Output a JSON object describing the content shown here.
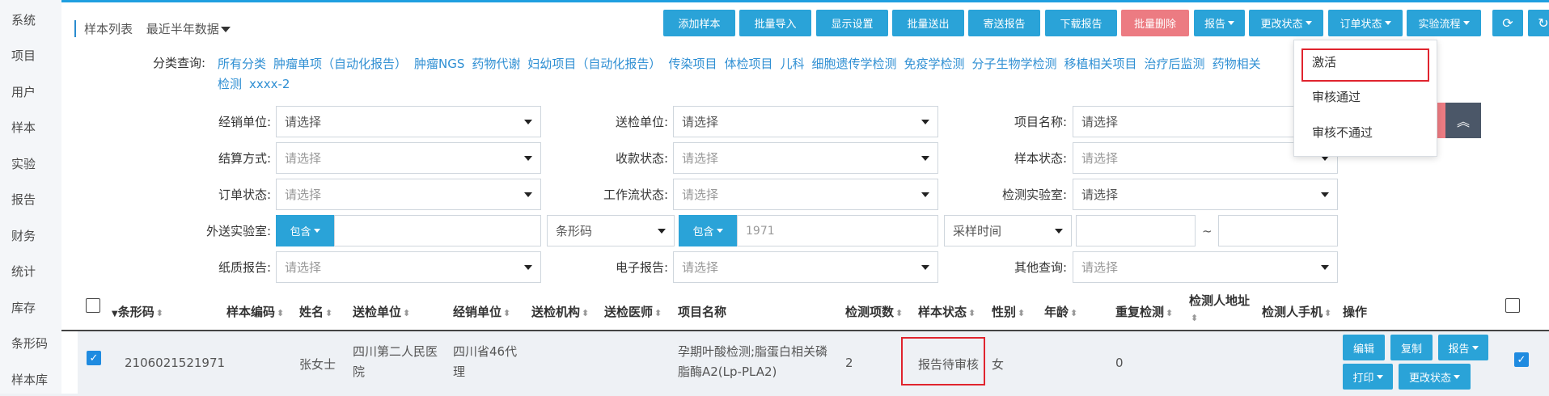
{
  "nav": [
    "系统",
    "项目",
    "用户",
    "样本",
    "实验",
    "报告",
    "财务",
    "统计",
    "库存",
    "条形码",
    "样本库"
  ],
  "header": {
    "title": "样本列表",
    "range": "最近半年数据"
  },
  "toolbar": [
    "添加样本",
    "批量导入",
    "显示设置",
    "批量送出",
    "寄送报告",
    "下载报告",
    "批量删除",
    "报告",
    "更改状态",
    "订单状态",
    "实验流程"
  ],
  "toolbar_icons": [
    "refresh-icon",
    "redo-icon"
  ],
  "categories": {
    "label": "分类查询:",
    "items": [
      "所有分类",
      "肿瘤单项（自动化报告）",
      "肿瘤NGS",
      "药物代谢",
      "妇幼项目（自动化报告）",
      "传染项目",
      "体检项目",
      "儿科",
      "细胞遗传学检测",
      "免疫学检测",
      "分子生物学检测",
      "移植相关项目",
      "治疗后监测",
      "药物相关检测",
      "xxxx-2"
    ]
  },
  "filters": {
    "dealer_label": "经销单位:",
    "dealer": "请选择",
    "send_label": "送检单位:",
    "send": "请选择",
    "project_label": "项目名称:",
    "project": "请选择",
    "settle_label": "结算方式:",
    "settle": "请选择",
    "pay_label": "收款状态:",
    "pay": "请选择",
    "sample_status_label": "样本状态:",
    "sample_status": "请选择",
    "order_label": "订单状态:",
    "order": "请选择",
    "workflow_label": "工作流状态:",
    "workflow": "请选择",
    "lab_label": "检测实验室:",
    "lab": "请选择",
    "outlab_label": "外送实验室:",
    "outlab_pill": "包含",
    "barcode_type": "条形码",
    "barcode_pill": "包含",
    "barcode_value": "1971",
    "time_type": "采样时间",
    "tilde": "~",
    "paper_label": "纸质报告:",
    "paper": "请选择",
    "ereport_label": "电子报告:",
    "ereport": "请选择",
    "other_label": "其他查询:",
    "other": "请选择"
  },
  "dropdown": [
    "激活",
    "审核通过",
    "审核不通过"
  ],
  "table": {
    "headers": [
      "条形码",
      "样本编码",
      "姓名",
      "送检单位",
      "经销单位",
      "送检机构",
      "送检医师",
      "项目名称",
      "检测项数",
      "样本状态",
      "性别",
      "年龄",
      "重复检测",
      "检测人地址",
      "检测人手机",
      "操作"
    ],
    "row": {
      "barcode": "2106021521971",
      "name": "张女士",
      "send_unit_1": "四川第二人民医",
      "send_unit_2": "院",
      "dealer_1": "四川省46代",
      "dealer_2": "理",
      "project_1": "孕期叶酸检测;脂蛋白相关磷",
      "project_2": "脂酶A2(Lp-PLA2)",
      "count": "2",
      "status": "报告待审核",
      "gender": "女",
      "repeat": "0",
      "actions": [
        "编辑",
        "复制",
        "报告",
        "打印",
        "更改状态"
      ]
    }
  },
  "colors": {
    "accent": "#2aa3d8",
    "danger": "#ec7b82",
    "highlight": "#e0242e"
  }
}
